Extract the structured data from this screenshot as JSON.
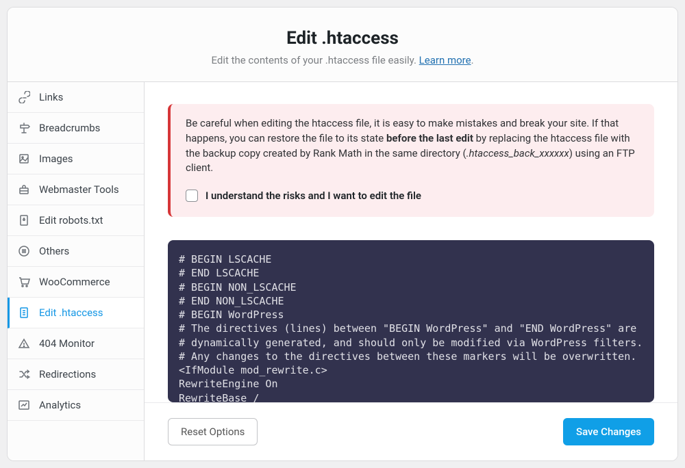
{
  "header": {
    "title": "Edit .htaccess",
    "subtitle_before": "Edit the contents of your .htaccess file easily. ",
    "learn_more": "Learn more",
    "period": "."
  },
  "sidebar": {
    "items": [
      {
        "id": "links",
        "label": "Links",
        "icon": "link-icon",
        "active": false
      },
      {
        "id": "breadcrumbs",
        "label": "Breadcrumbs",
        "icon": "signpost-icon",
        "active": false
      },
      {
        "id": "images",
        "label": "Images",
        "icon": "image-icon",
        "active": false
      },
      {
        "id": "webmaster-tools",
        "label": "Webmaster Tools",
        "icon": "toolbox-icon",
        "active": false
      },
      {
        "id": "edit-robots",
        "label": "Edit robots.txt",
        "icon": "file-robot-icon",
        "active": false
      },
      {
        "id": "others",
        "label": "Others",
        "icon": "lines-icon",
        "active": false
      },
      {
        "id": "woocommerce",
        "label": "WooCommerce",
        "icon": "cart-icon",
        "active": false
      },
      {
        "id": "edit-htaccess",
        "label": "Edit .htaccess",
        "icon": "file-icon",
        "active": true
      },
      {
        "id": "404-monitor",
        "label": "404 Monitor",
        "icon": "warning-icon",
        "active": false
      },
      {
        "id": "redirections",
        "label": "Redirections",
        "icon": "shuffle-icon",
        "active": false
      },
      {
        "id": "analytics",
        "label": "Analytics",
        "icon": "chart-icon",
        "active": false
      }
    ]
  },
  "alert": {
    "text_1": "Be careful when editing the htaccess file, it is easy to make mistakes and break your site. If that happens, you can restore the file to its state ",
    "bold": "before the last edit",
    "text_2": " by replacing the htaccess file with the backup copy created by Rank Math in the same directory (",
    "italic": ".htaccess_back_xxxxxx",
    "text_3": ") using an FTP client.",
    "ack_label": "I understand the risks and I want to edit the file"
  },
  "code": "# BEGIN LSCACHE\n# END LSCACHE\n# BEGIN NON_LSCACHE\n# END NON_LSCACHE\n# BEGIN WordPress\n# The directives (lines) between \"BEGIN WordPress\" and \"END WordPress\" are\n# dynamically generated, and should only be modified via WordPress filters.\n# Any changes to the directives between these markers will be overwritten.\n<IfModule mod_rewrite.c>\nRewriteEngine On\nRewriteBase /",
  "footer": {
    "reset": "Reset Options",
    "save": "Save Changes"
  }
}
